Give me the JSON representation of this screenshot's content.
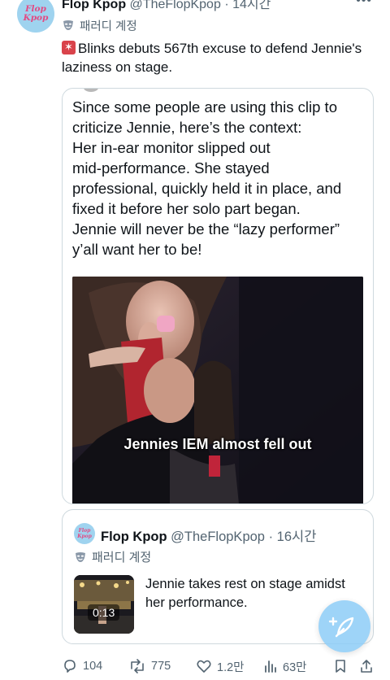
{
  "author": {
    "avatar_line1": "Flop",
    "avatar_line2": "Kpop",
    "name": "Flop Kpop",
    "handle": "@TheFlopKpop",
    "time": "· 14시간",
    "parody_label": "패러디 계정",
    "more_icon": "more-horizontal-icon"
  },
  "tweet": {
    "emoji_icon": "rotating-light-icon",
    "text": "Blinks debuts 567th excuse to defend Jennie's laziness on stage."
  },
  "quote_image": {
    "body": "Since some people are using this clip to\ncriticize Jennie, here’s the context:\nHer in-ear monitor slipped out\nmid-performance. She stayed\nprofessional, quickly held it in place, and\nfixed it before her solo part began.\nJennie will never be the “lazy performer”\ny’all want her to be!",
    "video_caption": "Jennies IEM almost fell out"
  },
  "quoted_tweet": {
    "avatar_line1": "Flop",
    "avatar_line2": "Kpop",
    "name": "Flop Kpop",
    "handle": "@TheFlopKpop",
    "time": "· 16시간",
    "parody_label": "패러디 계정",
    "video_duration": "0:13",
    "text": "Jennie takes rest on stage amidst her performance."
  },
  "compose_button": {
    "icon": "compose-feather-icon"
  },
  "actions": {
    "replies": "104",
    "reposts": "775",
    "likes": "1.2만",
    "views": "63만"
  },
  "colors": {
    "accent": "#1d9bf0",
    "secondary_text": "#536471",
    "border": "#cfd9de",
    "avatar_bg": "#9fd3ef",
    "avatar_text": "#e24a83"
  }
}
